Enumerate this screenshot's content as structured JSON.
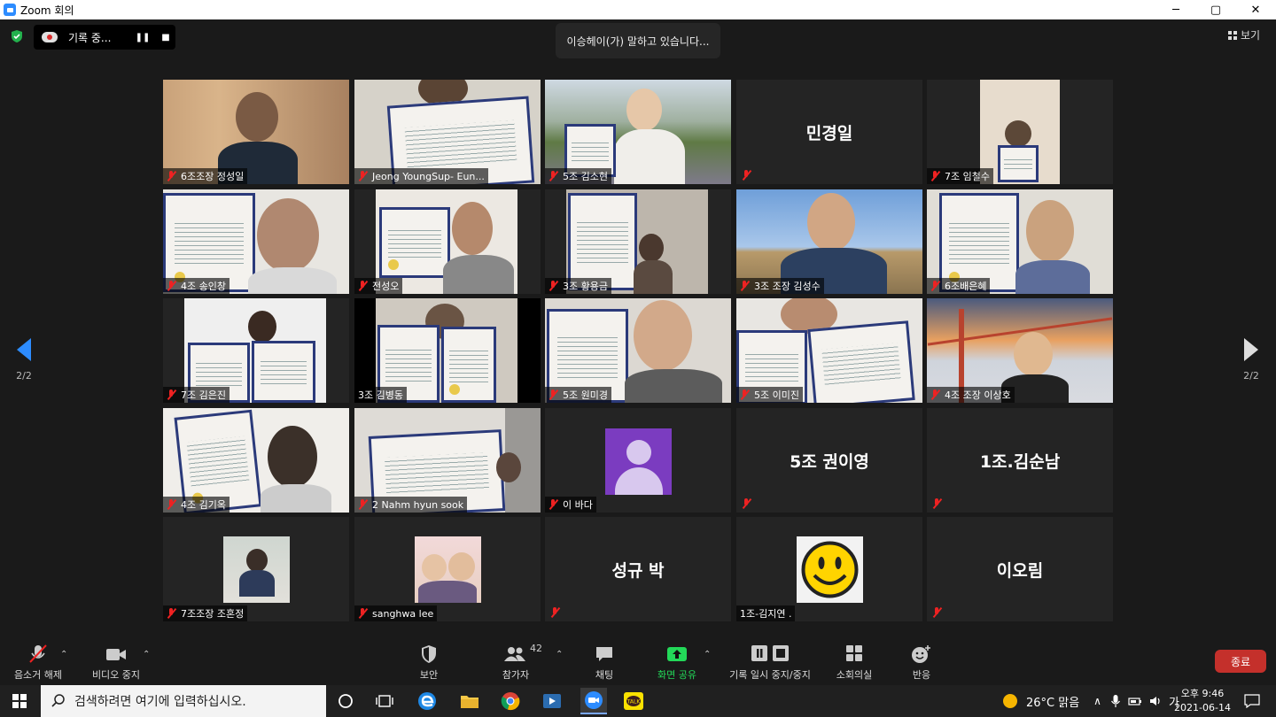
{
  "window": {
    "title": "Zoom 회의",
    "minimize": "─",
    "maximize": "▢",
    "close": "✕"
  },
  "recording": {
    "label": "기록 중...",
    "pause": "❚❚",
    "stop": "■"
  },
  "speaking_banner": "이승헤이(가) 말하고 있습니다...",
  "view_button": "보기",
  "pager": {
    "left": "2/2",
    "right": "2/2"
  },
  "tiles": [
    {
      "name": "6조조장 정성일",
      "muted": true
    },
    {
      "name": "Jeong YoungSup- Eun...",
      "muted": true
    },
    {
      "name": "5조 김소현",
      "muted": true
    },
    {
      "name": "",
      "display": "민경일",
      "muted": true
    },
    {
      "name": "7조 임철수",
      "muted": true
    },
    {
      "name": "4조 송인창",
      "muted": true
    },
    {
      "name": "전성오",
      "muted": true
    },
    {
      "name": "3조 황용금",
      "muted": true
    },
    {
      "name": "3조 조장 김성수",
      "muted": true
    },
    {
      "name": "6조배은혜",
      "muted": true
    },
    {
      "name": "7조 김은진",
      "muted": true
    },
    {
      "name": "3조 김병동",
      "muted": false
    },
    {
      "name": "5조 원미경",
      "muted": true
    },
    {
      "name": "5조 이미진",
      "muted": true
    },
    {
      "name": "4조 조장 이상호",
      "muted": true
    },
    {
      "name": "4조 김기옥",
      "muted": true
    },
    {
      "name": "2 Nahm hyun sook",
      "muted": true
    },
    {
      "name": "이 바다",
      "muted": true
    },
    {
      "name": "",
      "display": "5조 권이영",
      "muted": true
    },
    {
      "name": "",
      "display": "1조.김순남",
      "muted": true
    },
    {
      "name": "7조조장 조혼정",
      "muted": true
    },
    {
      "name": "sanghwa lee",
      "muted": true
    },
    {
      "name": "",
      "display": "성규 박",
      "muted": true
    },
    {
      "name": "1조-김지연 .",
      "muted": false
    },
    {
      "name": "",
      "display": "이오림",
      "muted": true
    }
  ],
  "toolbar": {
    "unmute": "음소거 해제",
    "stop_video": "비디오 중지",
    "security": "보안",
    "participants": "참가자",
    "participants_count": "42",
    "chat": "채팅",
    "share_screen": "화면 공유",
    "pause_stop_recording": "기록 일시 중지/중지",
    "breakout_rooms": "소회의실",
    "reactions": "반응",
    "end": "종료"
  },
  "taskbar": {
    "search_placeholder": "검색하려면 여기에 입력하십시오.",
    "weather": "26°C  맑음",
    "ime": "가",
    "time": "오후 9:46",
    "date": "2021-06-14"
  },
  "colors": {
    "accent": "#2d8cff",
    "end": "#c4302b",
    "share": "#23d959",
    "mute": "#e22222",
    "avatar": "#7b3cc0"
  }
}
